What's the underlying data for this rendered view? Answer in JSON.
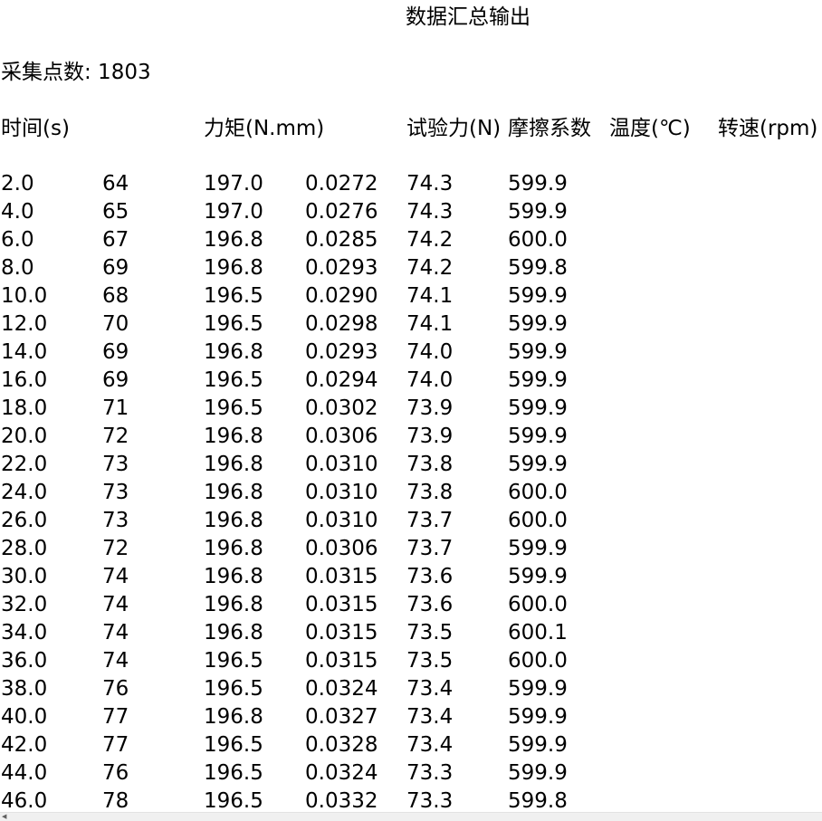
{
  "document": {
    "title": "数据汇总输出",
    "count_label": "采集点数: 1803"
  },
  "headers": [
    "时间(s)",
    "力矩(N.mm)",
    "试验力(N)",
    "摩擦系数",
    "温度(℃)",
    "转速(rpm)"
  ],
  "rows": [
    [
      "2.0",
      "64",
      "197.0",
      "0.0272",
      "74.3",
      "599.9"
    ],
    [
      "4.0",
      "65",
      "197.0",
      "0.0276",
      "74.3",
      "599.9"
    ],
    [
      "6.0",
      "67",
      "196.8",
      "0.0285",
      "74.2",
      "600.0"
    ],
    [
      "8.0",
      "69",
      "196.8",
      "0.0293",
      "74.2",
      "599.8"
    ],
    [
      "10.0",
      "68",
      "196.5",
      "0.0290",
      "74.1",
      "599.9"
    ],
    [
      "12.0",
      "70",
      "196.5",
      "0.0298",
      "74.1",
      "599.9"
    ],
    [
      "14.0",
      "69",
      "196.8",
      "0.0293",
      "74.0",
      "599.9"
    ],
    [
      "16.0",
      "69",
      "196.5",
      "0.0294",
      "74.0",
      "599.9"
    ],
    [
      "18.0",
      "71",
      "196.5",
      "0.0302",
      "73.9",
      "599.9"
    ],
    [
      "20.0",
      "72",
      "196.8",
      "0.0306",
      "73.9",
      "599.9"
    ],
    [
      "22.0",
      "73",
      "196.8",
      "0.0310",
      "73.8",
      "599.9"
    ],
    [
      "24.0",
      "73",
      "196.8",
      "0.0310",
      "73.8",
      "600.0"
    ],
    [
      "26.0",
      "73",
      "196.8",
      "0.0310",
      "73.7",
      "600.0"
    ],
    [
      "28.0",
      "72",
      "196.8",
      "0.0306",
      "73.7",
      "599.9"
    ],
    [
      "30.0",
      "74",
      "196.8",
      "0.0315",
      "73.6",
      "599.9"
    ],
    [
      "32.0",
      "74",
      "196.8",
      "0.0315",
      "73.6",
      "600.0"
    ],
    [
      "34.0",
      "74",
      "196.8",
      "0.0315",
      "73.5",
      "600.1"
    ],
    [
      "36.0",
      "74",
      "196.5",
      "0.0315",
      "73.5",
      "600.0"
    ],
    [
      "38.0",
      "76",
      "196.5",
      "0.0324",
      "73.4",
      "599.9"
    ],
    [
      "40.0",
      "77",
      "196.8",
      "0.0327",
      "73.4",
      "599.9"
    ],
    [
      "42.0",
      "77",
      "196.5",
      "0.0328",
      "73.4",
      "599.9"
    ],
    [
      "44.0",
      "76",
      "196.5",
      "0.0324",
      "73.3",
      "599.9"
    ],
    [
      "46.0",
      "78",
      "196.5",
      "0.0332",
      "73.3",
      "599.8"
    ]
  ],
  "icons": {
    "scroll_left": "chevron-left-icon"
  }
}
